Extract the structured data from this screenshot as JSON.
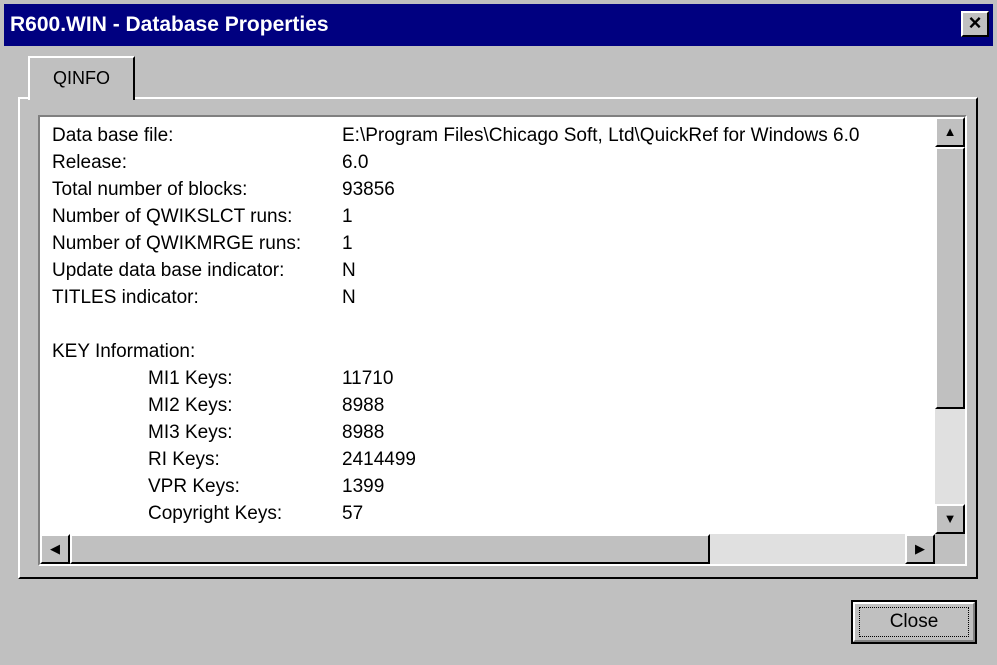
{
  "window": {
    "title": "R600.WIN - Database Properties"
  },
  "titlebar": {
    "close_glyph": "×"
  },
  "tabs": [
    {
      "label": "QINFO"
    }
  ],
  "info": [
    {
      "label": "Data base file:",
      "value": "E:\\Program Files\\Chicago Soft, Ltd\\QuickRef for Windows 6.0"
    },
    {
      "label": "Release:",
      "value": "6.0"
    },
    {
      "label": "Total number of blocks:",
      "value": "93856"
    },
    {
      "label": "Number of QWIKSLCT runs:",
      "value": "1"
    },
    {
      "label": "Number of QWIKMRGE runs:",
      "value": "1"
    },
    {
      "label": "Update data base indicator:",
      "value": "N"
    },
    {
      "label": "TITLES indicator:",
      "value": "N"
    }
  ],
  "key_info": {
    "heading": "KEY Information:",
    "rows": [
      {
        "label": "MI1 Keys:",
        "value": "11710"
      },
      {
        "label": "MI2 Keys:",
        "value": "8988"
      },
      {
        "label": "MI3 Keys:",
        "value": "8988"
      },
      {
        "label": "RI Keys:",
        "value": "2414499"
      },
      {
        "label": "VPR Keys:",
        "value": "1399"
      },
      {
        "label": "Copyright Keys:",
        "value": "57"
      }
    ]
  },
  "icons": {
    "scroll_up": "scroll-up-arrow-icon",
    "scroll_down": "scroll-down-arrow-icon",
    "scroll_left": "scroll-left-arrow-icon",
    "scroll_right": "scroll-right-arrow-icon"
  },
  "buttons": {
    "close_label": "Close"
  },
  "colors": {
    "titlebar": "#000080",
    "face": "#c0c0c0"
  }
}
